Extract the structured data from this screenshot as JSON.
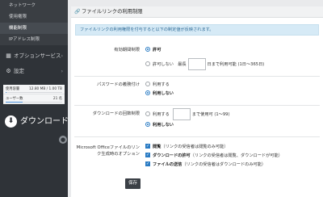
{
  "sidebar": {
    "sub_items": [
      {
        "label": "ネットワーク"
      },
      {
        "label": "使用権限"
      },
      {
        "label": "機能制限"
      },
      {
        "label": "IPアドレス制限"
      }
    ],
    "sections": [
      {
        "label": "オプションサービス",
        "icon": "grid-icon"
      },
      {
        "label": "設定",
        "icon": "gear-icon"
      }
    ],
    "usage": {
      "storage_label": "使用容量",
      "storage_value": "12.80 MB / 1.00 TB",
      "storage_fraction": 0.01,
      "users_label": "ユーザー数",
      "users_value": "21 名",
      "users_fraction": 0.3
    },
    "download_label": "ダウンロード"
  },
  "panel": {
    "title": "ファイルリンクの利用制限",
    "notice": "ファイルリンクの利用権限を付与すると以下の制定値が反映されます。",
    "expiry": {
      "label": "有効期間制限",
      "opt_allow": "許可",
      "opt_deny_prefix": "許可しない　最長",
      "opt_deny_suffix": "日まで利用可能 (1日〜365日)"
    },
    "password": {
      "label": "パスワードの義務付け",
      "opt_use": "利用する",
      "opt_nouse": "利用しない"
    },
    "download_limit": {
      "label": "ダウンロードの回数制限",
      "opt_use_prefix": "利用する",
      "opt_use_suffix": "まで使用可 (1〜99)",
      "opt_nouse": "利用しない"
    },
    "office": {
      "label": "Microsoft Officeファイルのリンク生成時のオプション",
      "opt_view_bold": "閲覧",
      "opt_view_rest": "（リンクの受信者は閲覧のみ可能）",
      "opt_dl_bold": "ダウンロードの許可",
      "opt_dl_rest": "（リンクの受信者は閲覧、ダウンロードが可能）",
      "opt_send_bold": "ファイルの送信",
      "opt_send_rest": "（リンクの受信者はダウンロードのみ可能）"
    },
    "save_label": "保存"
  },
  "colors": {
    "sidebar": "#2f3338",
    "accent": "#2b7cc4",
    "notice_bg": "#d6eaf6"
  }
}
